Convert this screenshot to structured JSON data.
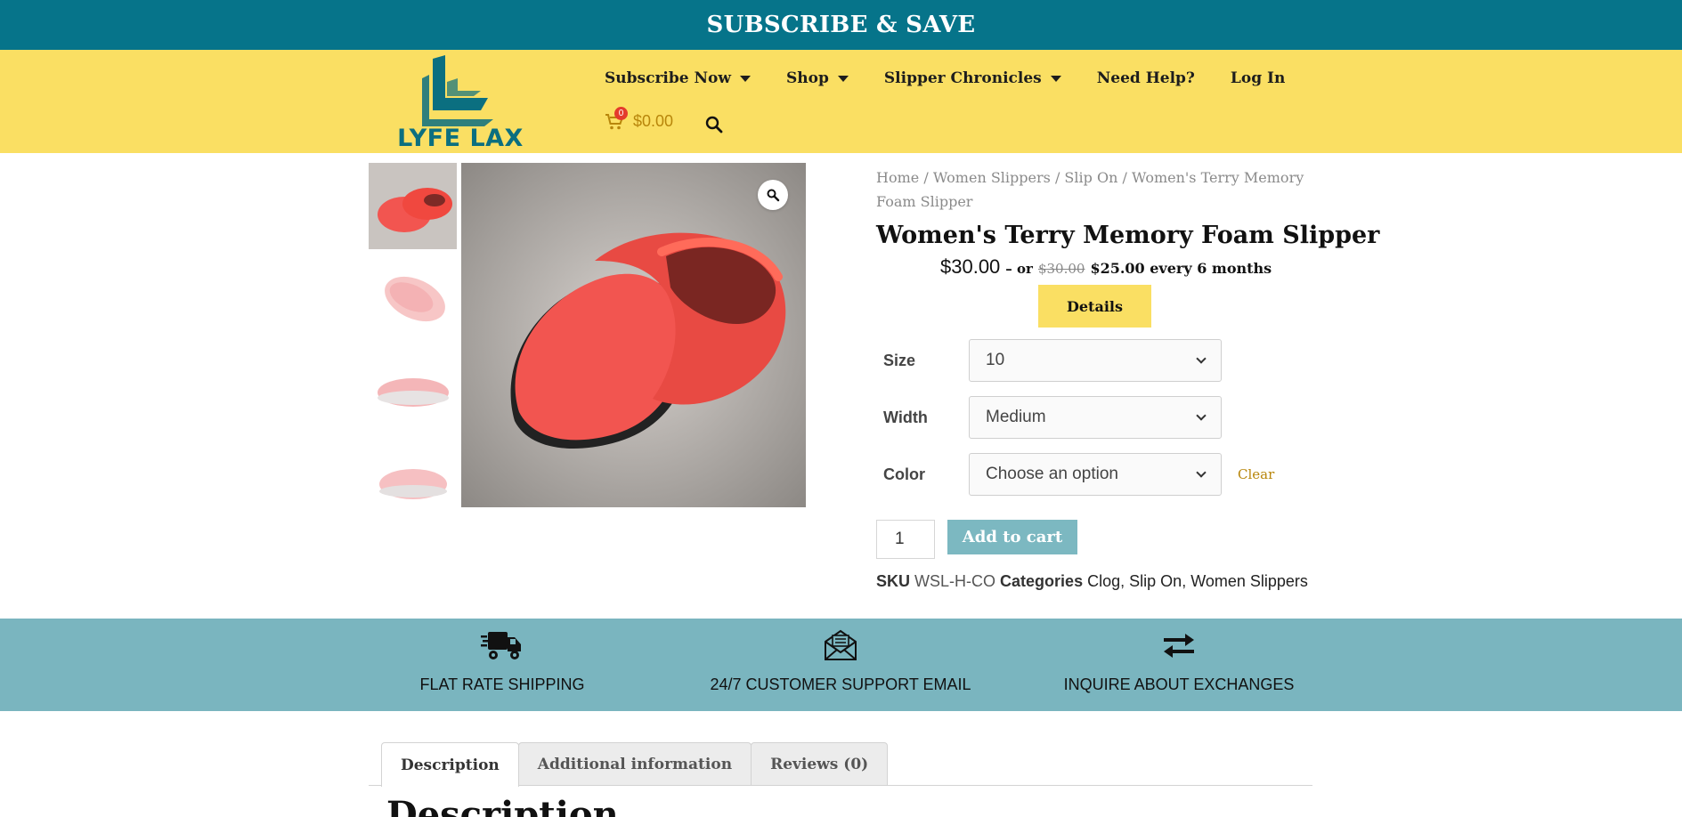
{
  "banner": {
    "text": "SUBSCRIBE & SAVE"
  },
  "logo": {
    "text": "LYFE LAX"
  },
  "nav": {
    "items": [
      {
        "label": "Subscribe Now",
        "dropdown": true
      },
      {
        "label": "Shop",
        "dropdown": true
      },
      {
        "label": "Slipper Chronicles",
        "dropdown": true
      },
      {
        "label": "Need Help?",
        "dropdown": false
      },
      {
        "label": "Log In",
        "dropdown": false
      }
    ],
    "cart_count": "0",
    "cart_total": "$0.00"
  },
  "breadcrumb": {
    "home": "Home",
    "sep": "/",
    "cat1": "Women Slippers",
    "cat2": "Slip On",
    "current": "Women's Terry Memory Foam Slipper"
  },
  "product": {
    "title": "Women's Terry Memory Foam Slipper",
    "price": "$30.00",
    "price_or": "– or",
    "price_original": "$30.00",
    "price_subscription": "$25.00 every 6 months",
    "details_label": "Details",
    "variations": [
      {
        "label": "Size",
        "value": "10"
      },
      {
        "label": "Width",
        "value": "Medium"
      },
      {
        "label": "Color",
        "value": "Choose an option"
      }
    ],
    "clear_label": "Clear",
    "quantity": "1",
    "add_to_cart_label": "Add to cart",
    "sku_label": "SKU",
    "sku": "WSL-H-CO",
    "categories_label": "Categories",
    "categories": [
      "Clog",
      "Slip On",
      "Women Slippers"
    ]
  },
  "features": [
    {
      "icon": "truck-icon",
      "label": "FLAT RATE SHIPPING"
    },
    {
      "icon": "envelope-icon",
      "label": "24/7 CUSTOMER SUPPORT EMAIL"
    },
    {
      "icon": "exchange-arrows-icon",
      "label": "INQUIRE ABOUT EXCHANGES"
    }
  ],
  "tabs": [
    {
      "label": "Description",
      "active": true
    },
    {
      "label": "Additional information",
      "active": false
    },
    {
      "label": "Reviews (0)",
      "active": false
    }
  ],
  "description_heading": "Description",
  "colors": {
    "banner": "#06748a",
    "header": "#fadf63",
    "features_band": "#7ab5bf",
    "add_to_cart": "#7cb8c1",
    "slipper_red": "#f25550",
    "clear_link": "#b8860b"
  }
}
